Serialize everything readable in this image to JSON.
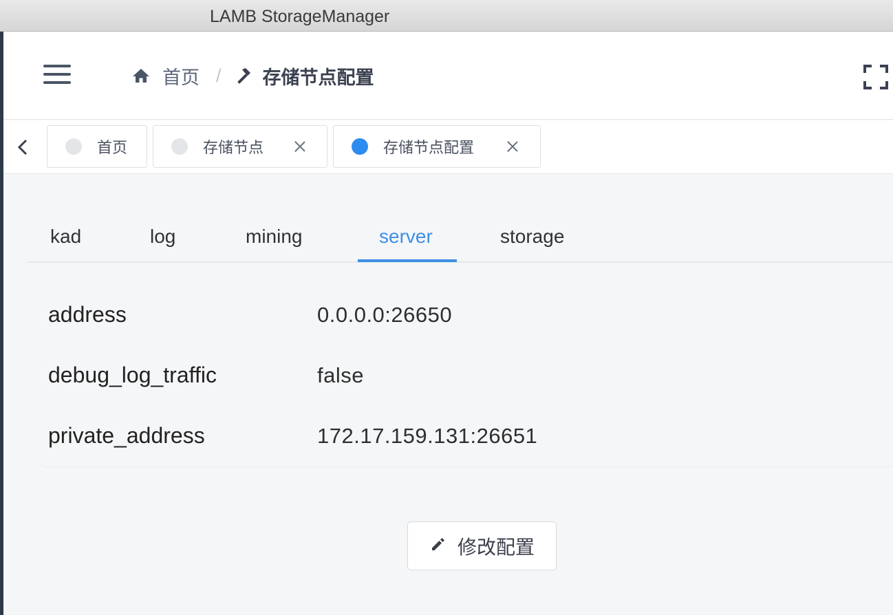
{
  "window": {
    "title": "LAMB StorageManager"
  },
  "header": {
    "menu_icon": "hamburger-icon",
    "breadcrumb": [
      {
        "label": "首页",
        "icon": "home-icon"
      },
      {
        "label": "存储节点配置",
        "icon": "hammer-icon"
      }
    ],
    "separator": "/",
    "fullscreen_icon": "fullscreen-icon"
  },
  "tags": [
    {
      "label": "首页",
      "active": false,
      "closable": false
    },
    {
      "label": "存储节点",
      "active": false,
      "closable": true
    },
    {
      "label": "存储节点配置",
      "active": true,
      "closable": true
    }
  ],
  "subtabs": {
    "items": [
      "kad",
      "log",
      "mining",
      "server",
      "storage"
    ],
    "active": "server"
  },
  "config": {
    "rows": [
      {
        "key": "address",
        "value": "0.0.0.0:26650"
      },
      {
        "key": "debug_log_traffic",
        "value": "false"
      },
      {
        "key": "private_address",
        "value": "172.17.159.131:26651"
      }
    ]
  },
  "actions": {
    "edit_label": "修改配置",
    "edit_icon": "pencil-icon"
  },
  "colors": {
    "accent": "#3d8fe5",
    "active_dot": "#2d8cf0",
    "sidebar": "#2e3a4b"
  }
}
